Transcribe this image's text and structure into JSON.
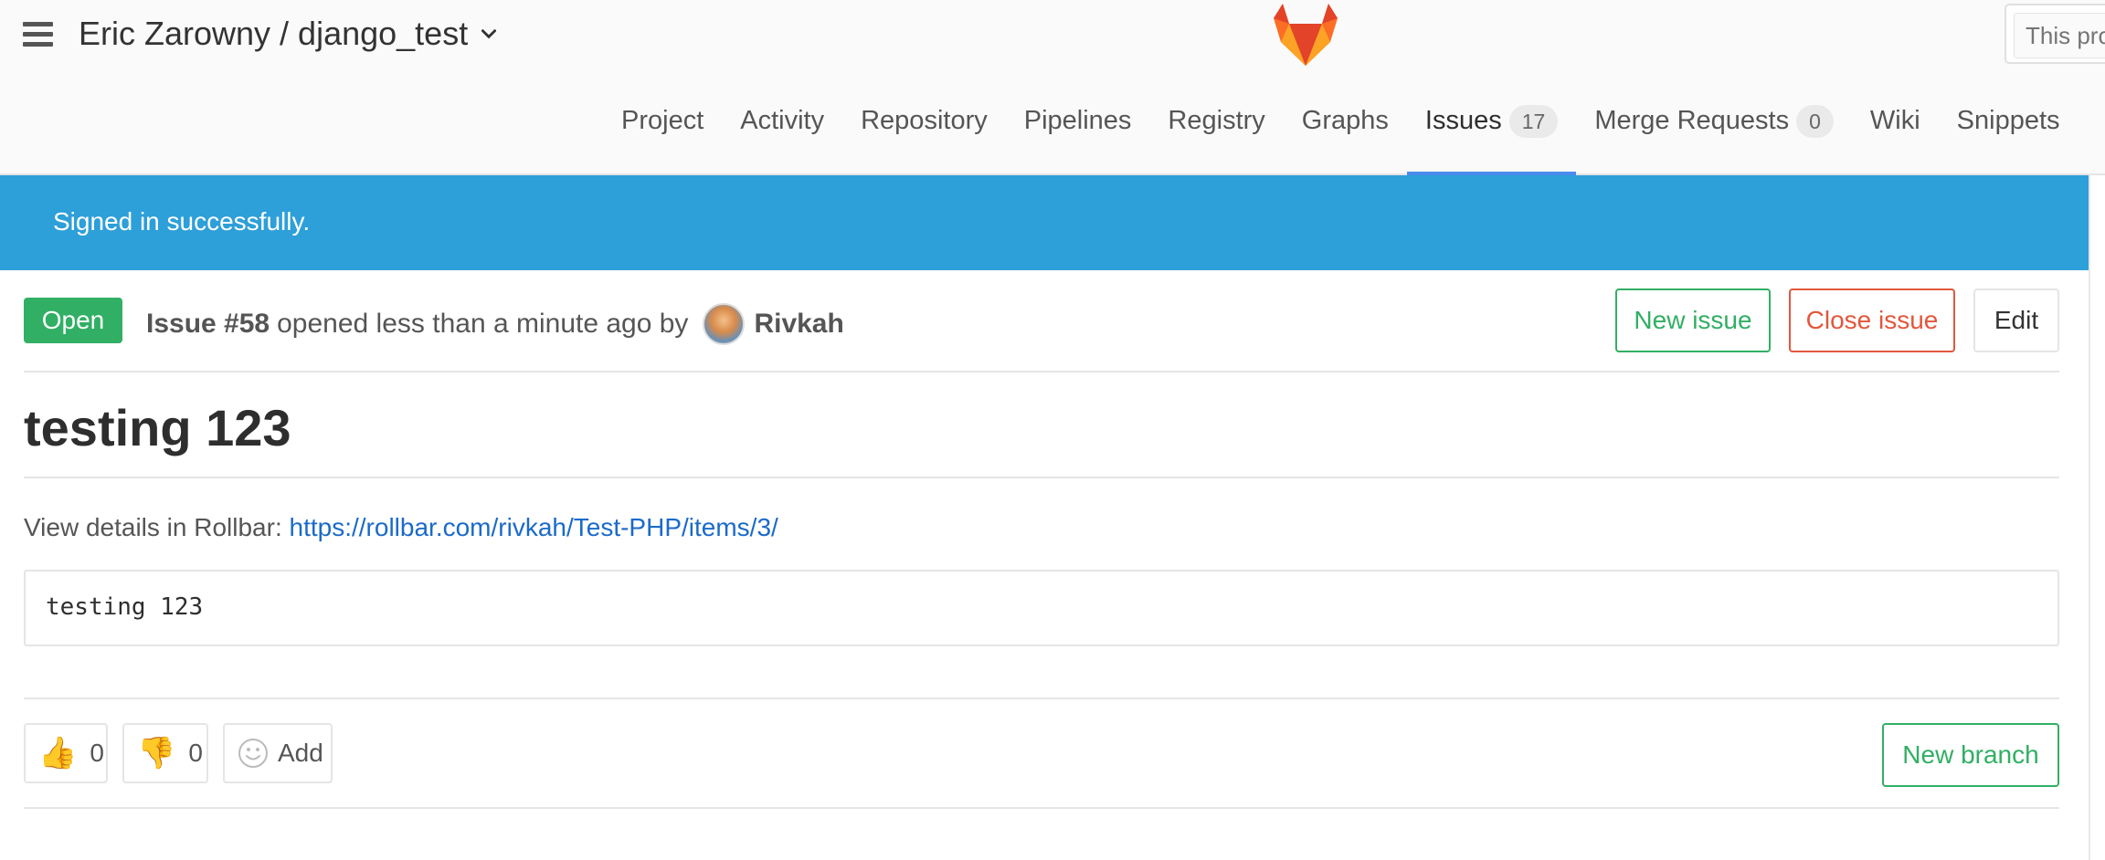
{
  "header": {
    "project_title": "Eric Zarowny / django_test",
    "search_placeholder": "This project",
    "nav": [
      {
        "label": "Project"
      },
      {
        "label": "Activity"
      },
      {
        "label": "Repository"
      },
      {
        "label": "Pipelines"
      },
      {
        "label": "Registry"
      },
      {
        "label": "Graphs"
      },
      {
        "label": "Issues",
        "badge": "17",
        "active": true
      },
      {
        "label": "Merge Requests",
        "badge": "0"
      },
      {
        "label": "Wiki"
      },
      {
        "label": "Snippets"
      }
    ]
  },
  "flash": {
    "message": "Signed in successfully."
  },
  "issue": {
    "status": "Open",
    "number": "Issue #58",
    "opened_text": "opened less than a minute ago by",
    "author": "Rivkah",
    "title": "testing 123",
    "details_prefix": "View details in Rollbar:",
    "details_link": "https://rollbar.com/rivkah/Test-PHP/items/3/",
    "code": "testing 123"
  },
  "actions": {
    "new_issue": "New issue",
    "close_issue": "Close issue",
    "edit": "Edit",
    "new_branch": "New branch"
  },
  "awards": {
    "thumbs_up": "0",
    "thumbs_down": "0",
    "add_label": "Add"
  },
  "colors": {
    "flash_bg": "#2d9fd9",
    "open_badge": "#31af64",
    "close_red": "#e2573c",
    "link_blue": "#1b6ac9",
    "active_tab_underline": "#4a8bee"
  }
}
